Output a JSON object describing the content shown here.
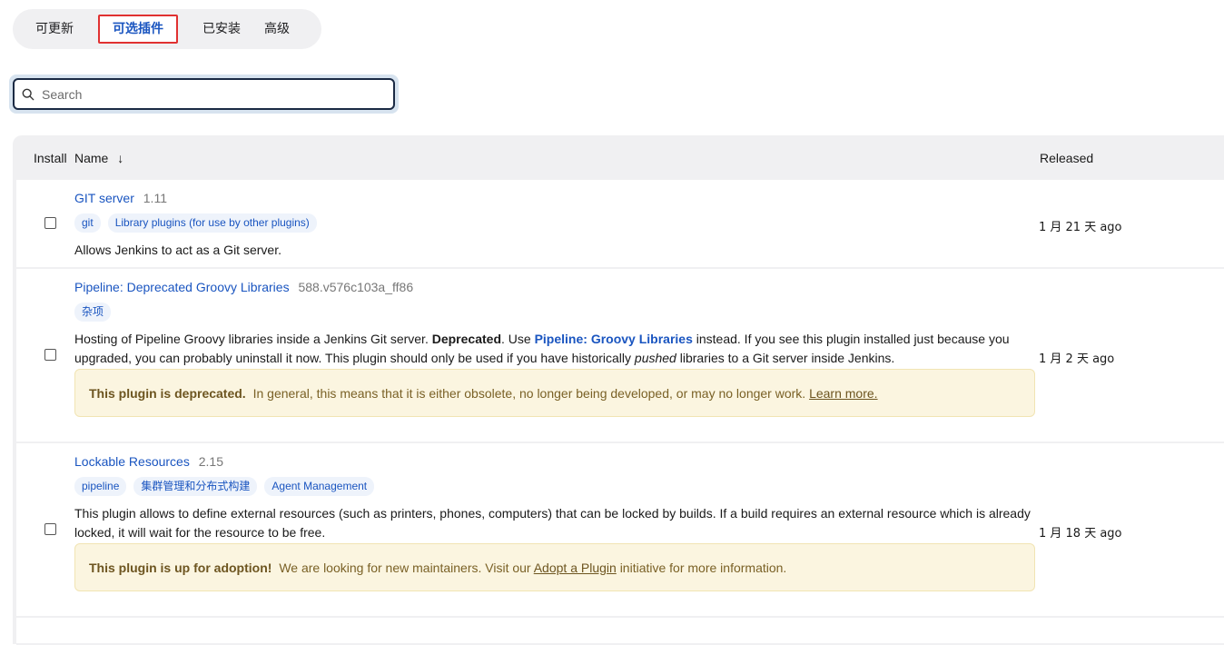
{
  "tabs": [
    "可更新",
    "可选插件",
    "已安装",
    "高级"
  ],
  "search": {
    "placeholder": "Search"
  },
  "table": {
    "headers": {
      "install": "Install",
      "name": "Name",
      "sort_arrow": "↓",
      "released": "Released"
    },
    "rows": [
      {
        "name": "GIT server",
        "version": "1.11",
        "tags": [
          "git",
          "Library plugins (for use by other plugins)"
        ],
        "description": "Allows Jenkins to act as a Git server.",
        "released": "1 月 21 天 ago"
      },
      {
        "name": "Pipeline: Deprecated Groovy Libraries",
        "version": "588.v576c103a_ff86",
        "tags": [
          "杂项"
        ],
        "description_parts": {
          "p1": "Hosting of Pipeline Groovy libraries inside a Jenkins Git server. ",
          "bold": "Deprecated",
          "p2": ". Use ",
          "link": "Pipeline: Groovy Libraries",
          "p3": " instead. If you see this plugin installed just because you upgraded, you can probably uninstall it now. This plugin should only be used if you have historically ",
          "italic": "pushed",
          "p4": " libraries to a Git server inside Jenkins."
        },
        "notice": {
          "bold": "This plugin is deprecated.",
          "text": "In general, this means that it is either obsolete, no longer being developed, or may no longer work.",
          "link": "Learn more."
        },
        "released": "1 月 2 天 ago"
      },
      {
        "name": "Lockable Resources",
        "version": "2.15",
        "tags": [
          "pipeline",
          "集群管理和分布式构建",
          "Agent Management"
        ],
        "description": "This plugin allows to define external resources (such as printers, phones, computers) that can be locked by builds. If a build requires an external resource which is already locked, it will wait for the resource to be free.",
        "notice": {
          "bold": "This plugin is up for adoption!",
          "text": "We are looking for new maintainers. Visit our",
          "link": "Adopt a Plugin",
          "text2": "initiative for more information."
        },
        "released": "1 月 18 天 ago"
      }
    ]
  }
}
